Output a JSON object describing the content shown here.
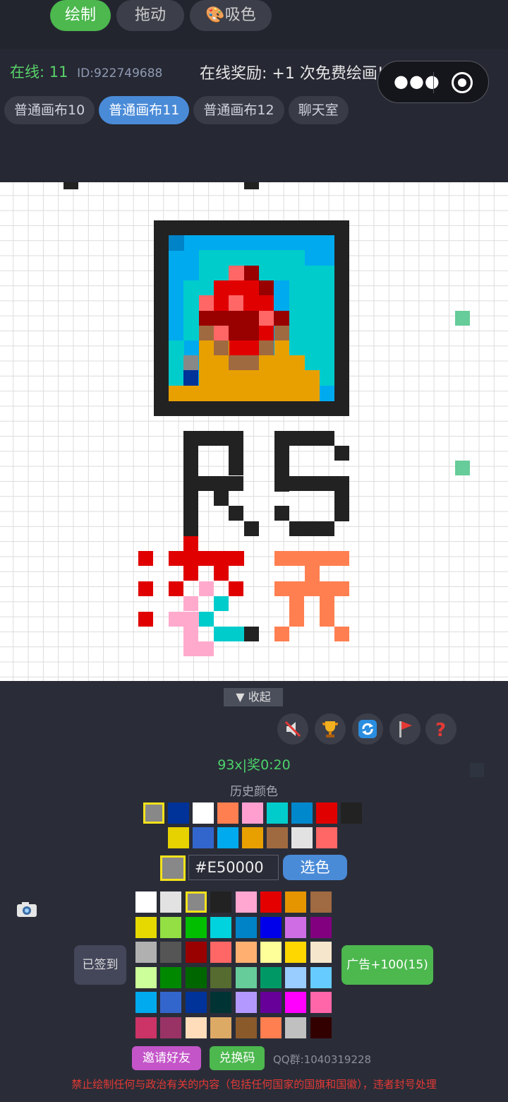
{
  "header": {
    "online_label": "在线: 11",
    "user_id": "ID:922749688",
    "reward_text": "在线奖励: +1 次免费绘画!",
    "capsule": {
      "more_icon": "more-dots-icon",
      "close_icon": "target-icon"
    }
  },
  "tabs": [
    {
      "label": "普通画布10",
      "active": false
    },
    {
      "label": "普通画布11",
      "active": true
    },
    {
      "label": "普通画布12",
      "active": false
    },
    {
      "label": "聊天室",
      "active": false
    }
  ],
  "canvas": {
    "description_colors": [
      "#222222",
      "#00aaee",
      "#00cccc",
      "#e00000",
      "#ff6666",
      "#990000",
      "#e8a000",
      "#a06a40",
      "#888888",
      "#003399",
      "#ff7f50",
      "#ffaacc",
      "#66cc99"
    ]
  },
  "panel": {
    "collapse_label": "▼ 收起",
    "tools": {
      "draw": "绘制",
      "drag": "拖动",
      "pick": "吸色",
      "pick_icon": "palette-icon"
    },
    "icons": [
      "mute-icon",
      "trophy-icon",
      "refresh-icon",
      "flag-icon",
      "help-icon"
    ],
    "ratio_text": "93x|奖0:20",
    "history_title": "历史颜色",
    "history_colors_row1": [
      "#888888",
      "#003399",
      "#ffffff",
      "#ff7f50",
      "#ff9fd0",
      "#00cccc",
      "#0088cc",
      "#e00000",
      "#222222"
    ],
    "history_colors_row2": [
      "#e6d200",
      "#3366cc",
      "#00aaee",
      "#e8a000",
      "#a06a40",
      "#e2e2e2",
      "#ff6666"
    ],
    "current_color": "#888888",
    "hex_value": "#E50000",
    "pick_button": "选色",
    "palette": [
      [
        "#ffffff",
        "#e2e2e2",
        "#888888",
        "#222222",
        "#ffa7d1",
        "#e50000",
        "#e59500",
        "#a06a42"
      ],
      [
        "#e5d900",
        "#94e044",
        "#02be01",
        "#00d3dd",
        "#0083c7",
        "#0000ea",
        "#cf6ee4",
        "#820080"
      ],
      [
        "#b0b0b0",
        "#555555",
        "#990000",
        "#ff6666",
        "#ffb070",
        "#ffff99",
        "#ffd700",
        "#f5e6cc"
      ],
      [
        "#ccff99",
        "#008800",
        "#006600",
        "#556b2f",
        "#66cc99",
        "#009966",
        "#99ccff",
        "#66ccff"
      ],
      [
        "#00aaee",
        "#3366cc",
        "#003399",
        "#003333",
        "#b399ff",
        "#660099",
        "#ff00ff",
        "#ff66aa"
      ],
      [
        "#cc3366",
        "#993366",
        "#ffddbb",
        "#ddaa66",
        "#8b5a2b",
        "#ff7f50",
        "#c0c0c0",
        "#330000"
      ]
    ],
    "selected_palette_index": [
      0,
      2
    ],
    "signed_label": "已签到",
    "ad_label": "广告+100(15)",
    "invite_label": "邀请好友",
    "redeem_label": "兑换码",
    "qq_group": "QQ群:1040319228",
    "warning": "禁止绘制任何与政治有关的内容（包括任何国家的国旗和国徽），违者封号处理",
    "camera_icon": "camera-icon"
  }
}
